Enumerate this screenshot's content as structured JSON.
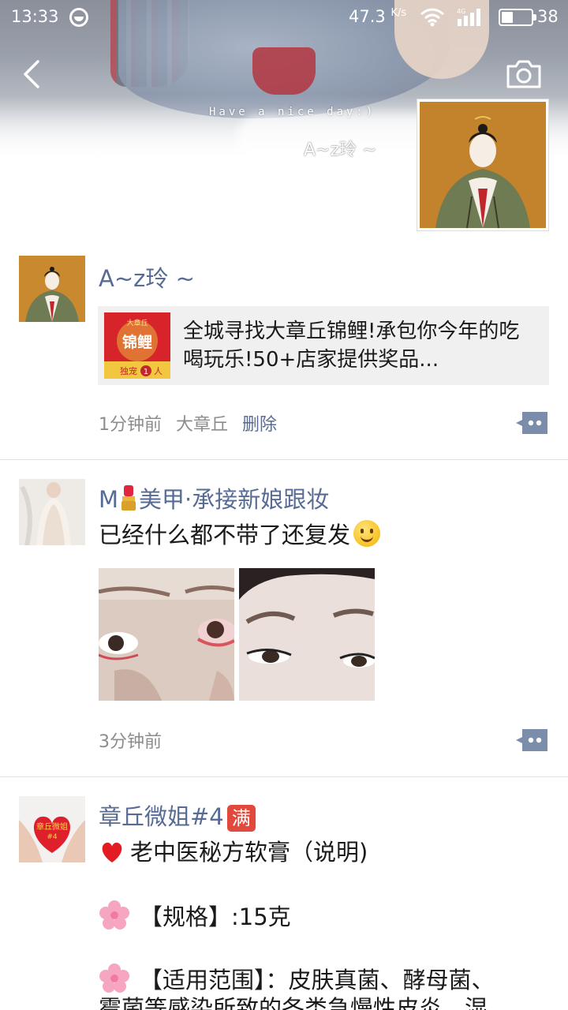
{
  "status_bar": {
    "time": "13:33",
    "net_speed": "47.3",
    "net_unit": "K/s",
    "network_type": "4G",
    "battery": "38",
    "battery_level_percent": 38
  },
  "cover": {
    "tagline": "Have a nice day:)",
    "user_name": "A~z玲 ~"
  },
  "posts": [
    {
      "author": "A~z玲 ~",
      "share_title": "全城寻找大章丘锦鲤!承包你今年的吃喝玩乐!50+店家提供奖品...",
      "share_line1": "全城寻找大章丘锦鲤!承包你今年的吃",
      "share_line2": "喝玩乐!50+店家提供奖品...",
      "share_thumb": {
        "top": "大章丘",
        "main": "锦鲤",
        "bottom_a": "独宠",
        "bottom_num": "1",
        "bottom_b": "人"
      },
      "time": "1分钟前",
      "location": "大章丘",
      "delete_label": "删除"
    },
    {
      "author_prefix": "M",
      "author_rest": "美甲·承接新娘跟妆",
      "text": "已经什么都不带了还复发",
      "time": "3分钟前"
    },
    {
      "author_main": "章丘微姐#4",
      "author_badge": "满",
      "avatar_text_1": "章丘微姐",
      "avatar_text_2": "#4",
      "line1": "老中医秘方软膏（说明)",
      "line2": "【规格】:15克",
      "line3": "【适用范围】：皮肤真菌、酵母菌、",
      "line4": "霉菌等感染所致的各类急慢性皮炎、湿"
    }
  ],
  "colors": {
    "name_blue": "#576b95",
    "meta_gray": "#8c8c8c",
    "card_bg": "#f0f0f0",
    "divider": "#e2e2e2"
  },
  "icons": [
    "back-icon",
    "camera-icon",
    "comment-icon",
    "wifi-icon",
    "signal-icon",
    "battery-icon",
    "sync-icon"
  ]
}
